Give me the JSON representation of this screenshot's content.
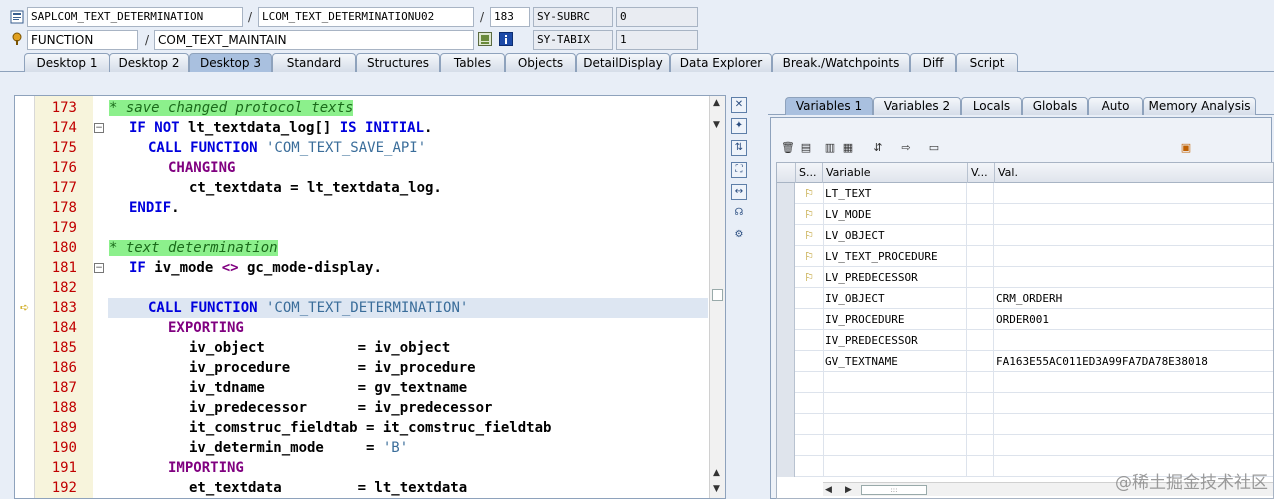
{
  "status_row1": {
    "program": "SAPLCOM_TEXT_DETERMINATION",
    "include": "LCOM_TEXT_DETERMINATIONU02",
    "line": "183",
    "sysfield1_name": "SY-SUBRC",
    "sysfield1_value": "0"
  },
  "status_row2": {
    "event_type": "FUNCTION",
    "event_name": "COM_TEXT_MAINTAIN",
    "sysfield2_name": "SY-TABIX",
    "sysfield2_value": "1"
  },
  "desktop_tabs": [
    "Desktop 1",
    "Desktop 2",
    "Desktop 3",
    "Standard",
    "Structures",
    "Tables",
    "Objects",
    "DetailDisplay",
    "Data Explorer",
    "Break./Watchpoints",
    "Diff",
    "Script"
  ],
  "active_desktop_tab": "Desktop 3",
  "code_lines": [
    {
      "no": "173"
    },
    {
      "no": "174"
    },
    {
      "no": "175"
    },
    {
      "no": "176"
    },
    {
      "no": "177"
    },
    {
      "no": "178"
    },
    {
      "no": "179"
    },
    {
      "no": "180"
    },
    {
      "no": "181"
    },
    {
      "no": "182"
    },
    {
      "no": "183"
    },
    {
      "no": "184"
    },
    {
      "no": "185"
    },
    {
      "no": "186"
    },
    {
      "no": "187"
    },
    {
      "no": "188"
    },
    {
      "no": "189"
    },
    {
      "no": "190"
    },
    {
      "no": "191"
    },
    {
      "no": "192"
    }
  ],
  "code": {
    "l173_comment": "* save changed protocol texts",
    "l174_kw1": "IF NOT",
    "l174_var": " lt_textdata_log[] ",
    "l174_kw2": "IS INITIAL",
    "l174_end": ".",
    "l175_kw": "CALL FUNCTION",
    "l175_str": " 'COM_TEXT_SAVE_API'",
    "l176_kw": "CHANGING",
    "l177_text": "ct_textdata = lt_textdata_log.",
    "l178_kw": "ENDIF",
    "l178_end": ".",
    "l180_comment": "* text determination",
    "l181_kw": "IF",
    "l181_text": " iv_mode ",
    "l181_op": "<>",
    "l181_text2": " gc_mode-display.",
    "l183_kw": "CALL FUNCTION",
    "l183_str": " 'COM_TEXT_DETERMINATION'",
    "l184_kw": "EXPORTING",
    "l185_text": "iv_object           = iv_object",
    "l186_text": "iv_procedure        = iv_procedure",
    "l187_text": "iv_tdname           = gv_textname",
    "l188_text": "iv_predecessor      = iv_predecessor",
    "l189_text": "it_comstruc_fieldtab = it_comstruc_fieldtab",
    "l190_text": "iv_determin_mode     = ",
    "l190_str": "'B'",
    "l191_kw": "IMPORTING",
    "l192_text": "et_textdata         = lt_textdata"
  },
  "right_tabs": [
    "Variables 1",
    "Variables 2",
    "Locals",
    "Globals",
    "Auto",
    "Memory Analysis"
  ],
  "active_right_tab": "Variables 1",
  "variables_table": {
    "headers": {
      "status": "S...",
      "variable": "Variable",
      "v": "V...",
      "value": "Val."
    },
    "rows": [
      {
        "variable": "LT_TEXT",
        "value": "",
        "marker": true
      },
      {
        "variable": "LV_MODE",
        "value": "",
        "marker": true
      },
      {
        "variable": "LV_OBJECT",
        "value": "",
        "marker": true
      },
      {
        "variable": "LV_TEXT_PROCEDURE",
        "value": "",
        "marker": true
      },
      {
        "variable": "LV_PREDECESSOR",
        "value": "",
        "marker": true
      },
      {
        "variable": "IV_OBJECT",
        "value": "CRM_ORDERH",
        "marker": false
      },
      {
        "variable": "IV_PROCEDURE",
        "value": "ORDER001",
        "marker": false
      },
      {
        "variable": "IV_PREDECESSOR",
        "value": "",
        "marker": false
      },
      {
        "variable": "GV_TEXTNAME",
        "value": "FA163E55AC011ED3A99FA7DA78E38018",
        "marker": false
      },
      {
        "variable": "",
        "value": "",
        "marker": false
      },
      {
        "variable": "",
        "value": "",
        "marker": false
      },
      {
        "variable": "",
        "value": "",
        "marker": false
      },
      {
        "variable": "",
        "value": "",
        "marker": false
      },
      {
        "variable": "",
        "value": "",
        "marker": false
      }
    ]
  },
  "watermark": "@稀土掘金技术社区",
  "colors": {
    "accent_tab": "#a9c0df",
    "line_number": "#c00000",
    "keyword": "#0000dd",
    "comment_bg": "#8cf08c"
  }
}
